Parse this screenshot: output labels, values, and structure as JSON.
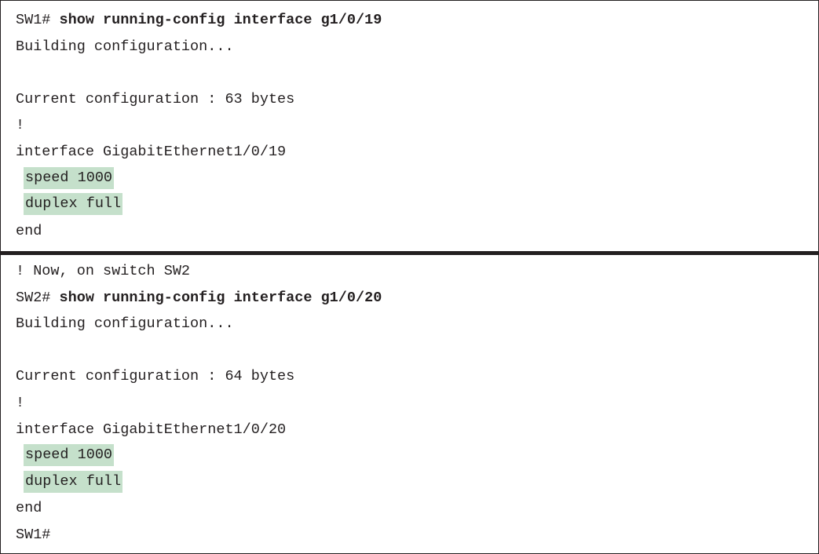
{
  "sw1_block": {
    "prompt": "SW1#",
    "command": "show running-config interface g1/0/19",
    "building": "Building configuration...",
    "current_config": "Current configuration : 63 bytes",
    "bang": "!",
    "interface": "interface GigabitEthernet1/0/19",
    "speed": "speed 1000",
    "duplex": "duplex full",
    "end": "end"
  },
  "sw2_block": {
    "comment": "! Now, on switch SW2",
    "prompt": "SW2#",
    "command": "show running-config interface g1/0/20",
    "building": "Building configuration...",
    "current_config": "Current configuration : 64 bytes",
    "bang": "!",
    "interface": "interface GigabitEthernet1/0/20",
    "speed": "speed 1000",
    "duplex": "duplex full",
    "end": "end",
    "final_prompt": "SW1#"
  },
  "colors": {
    "highlight": "#c5e0cb",
    "text": "#231f20",
    "border": "#231f20"
  }
}
